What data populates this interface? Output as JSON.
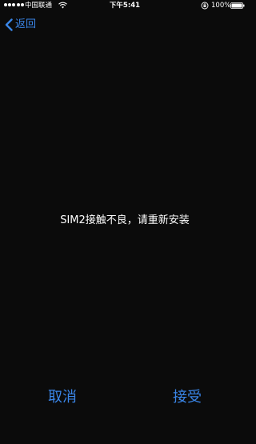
{
  "status_bar": {
    "carrier": "中国联通",
    "time": "下午5:41",
    "battery_percent": "100%",
    "battery_level": 1.0,
    "signal_bars": 5
  },
  "nav": {
    "back_label": "返回"
  },
  "message": "SIM2接触不良，请重新安装",
  "actions": {
    "cancel_label": "取消",
    "accept_label": "接受"
  },
  "colors": {
    "background": "#0b0b0b",
    "accent": "#3a86e8",
    "text": "#ffffff"
  },
  "icons": {
    "signal": "signal-dots-icon",
    "wifi": "wifi-icon",
    "orientation_lock": "orientation-lock-icon",
    "battery": "battery-icon",
    "back": "chevron-left-icon"
  }
}
